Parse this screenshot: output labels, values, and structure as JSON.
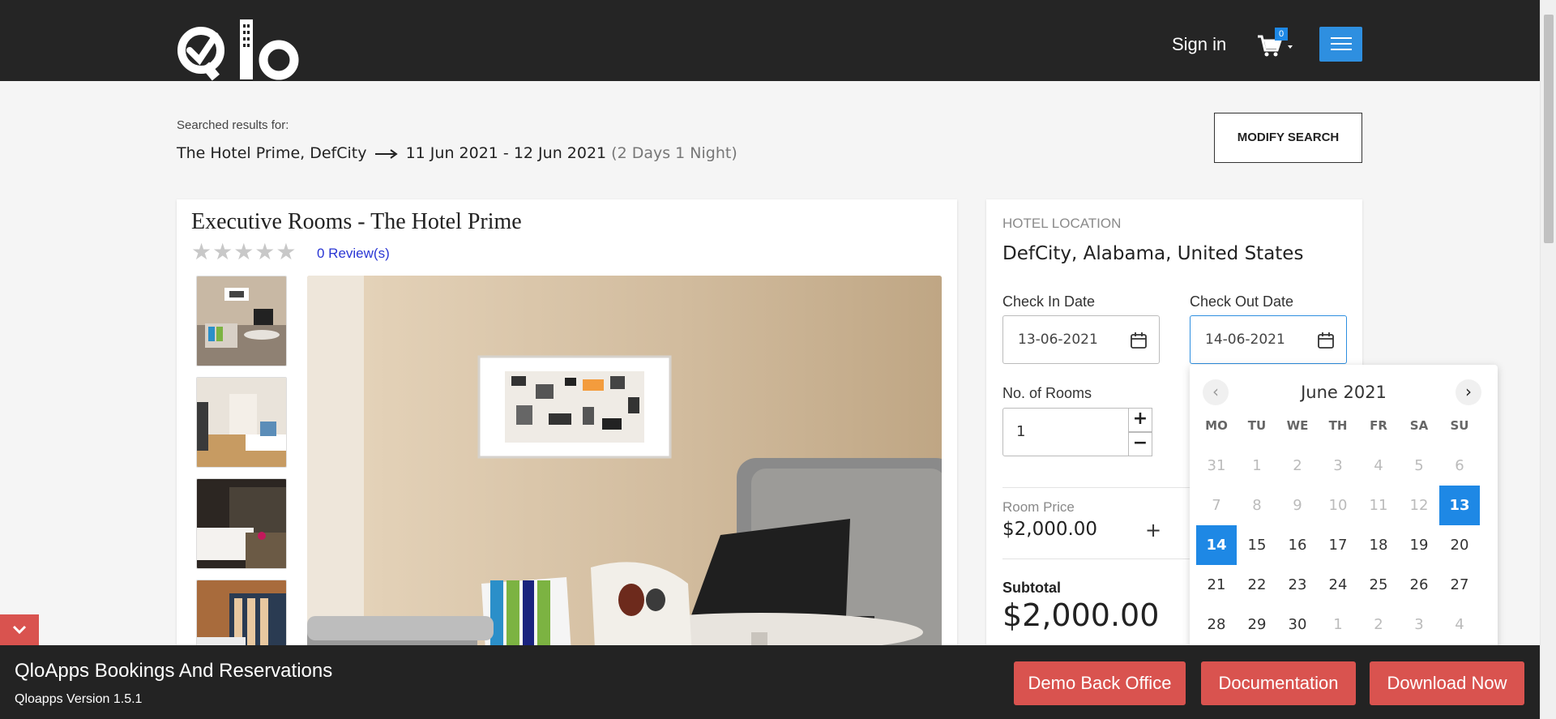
{
  "header": {
    "logo_text": "Qlo",
    "signin_label": "Sign in",
    "cart_count": "0",
    "icons": [
      "cart-icon",
      "menu-icon"
    ]
  },
  "search": {
    "label": "Searched results for:",
    "hotel_city": "The Hotel Prime, DefCity",
    "dates": "11 Jun 2021 - 12 Jun 2021",
    "duration": "(2 Days 1 Night)",
    "modify_label": "MODIFY SEARCH"
  },
  "room": {
    "title": "Executive Rooms - The Hotel Prime",
    "stars": "★★★★★",
    "reviews_label": "0  Review(s)"
  },
  "booking": {
    "hotel_location_label": "HOTEL LOCATION",
    "hotel_location_value": "DefCity, Alabama, United States",
    "check_in_label": "Check In Date",
    "check_in_value": "13-06-2021",
    "check_out_label": "Check Out Date",
    "check_out_value": "14-06-2021",
    "rooms_label": "No. of Rooms",
    "rooms_value": "1",
    "room_price_label": "Room Price",
    "room_price_value": "$2,000.00",
    "plus_sign": "+",
    "subtotal_label": "Subtotal",
    "subtotal_value": "$2,000.00"
  },
  "datepicker": {
    "month_label": "June 2021",
    "prev_label": "‹",
    "next_label": "›",
    "weekdays": [
      "MO",
      "TU",
      "WE",
      "TH",
      "FR",
      "SA",
      "SU"
    ],
    "weeks": [
      [
        "31",
        "1",
        "2",
        "3",
        "4",
        "5",
        "6"
      ],
      [
        "7",
        "8",
        "9",
        "10",
        "11",
        "12",
        "13"
      ],
      [
        "14",
        "15",
        "16",
        "17",
        "18",
        "19",
        "20"
      ],
      [
        "21",
        "22",
        "23",
        "24",
        "25",
        "26",
        "27"
      ],
      [
        "28",
        "29",
        "30",
        "1",
        "2",
        "3",
        "4"
      ]
    ],
    "selected_start": "13",
    "selected_end": "14",
    "selected_color": "#1e88e5"
  },
  "footer": {
    "title": "QloApps Bookings And Reservations",
    "version": "Qloapps Version 1.5.1",
    "buttons": [
      "Demo Back Office",
      "Documentation",
      "Download Now"
    ],
    "button_color": "#d9534f"
  }
}
